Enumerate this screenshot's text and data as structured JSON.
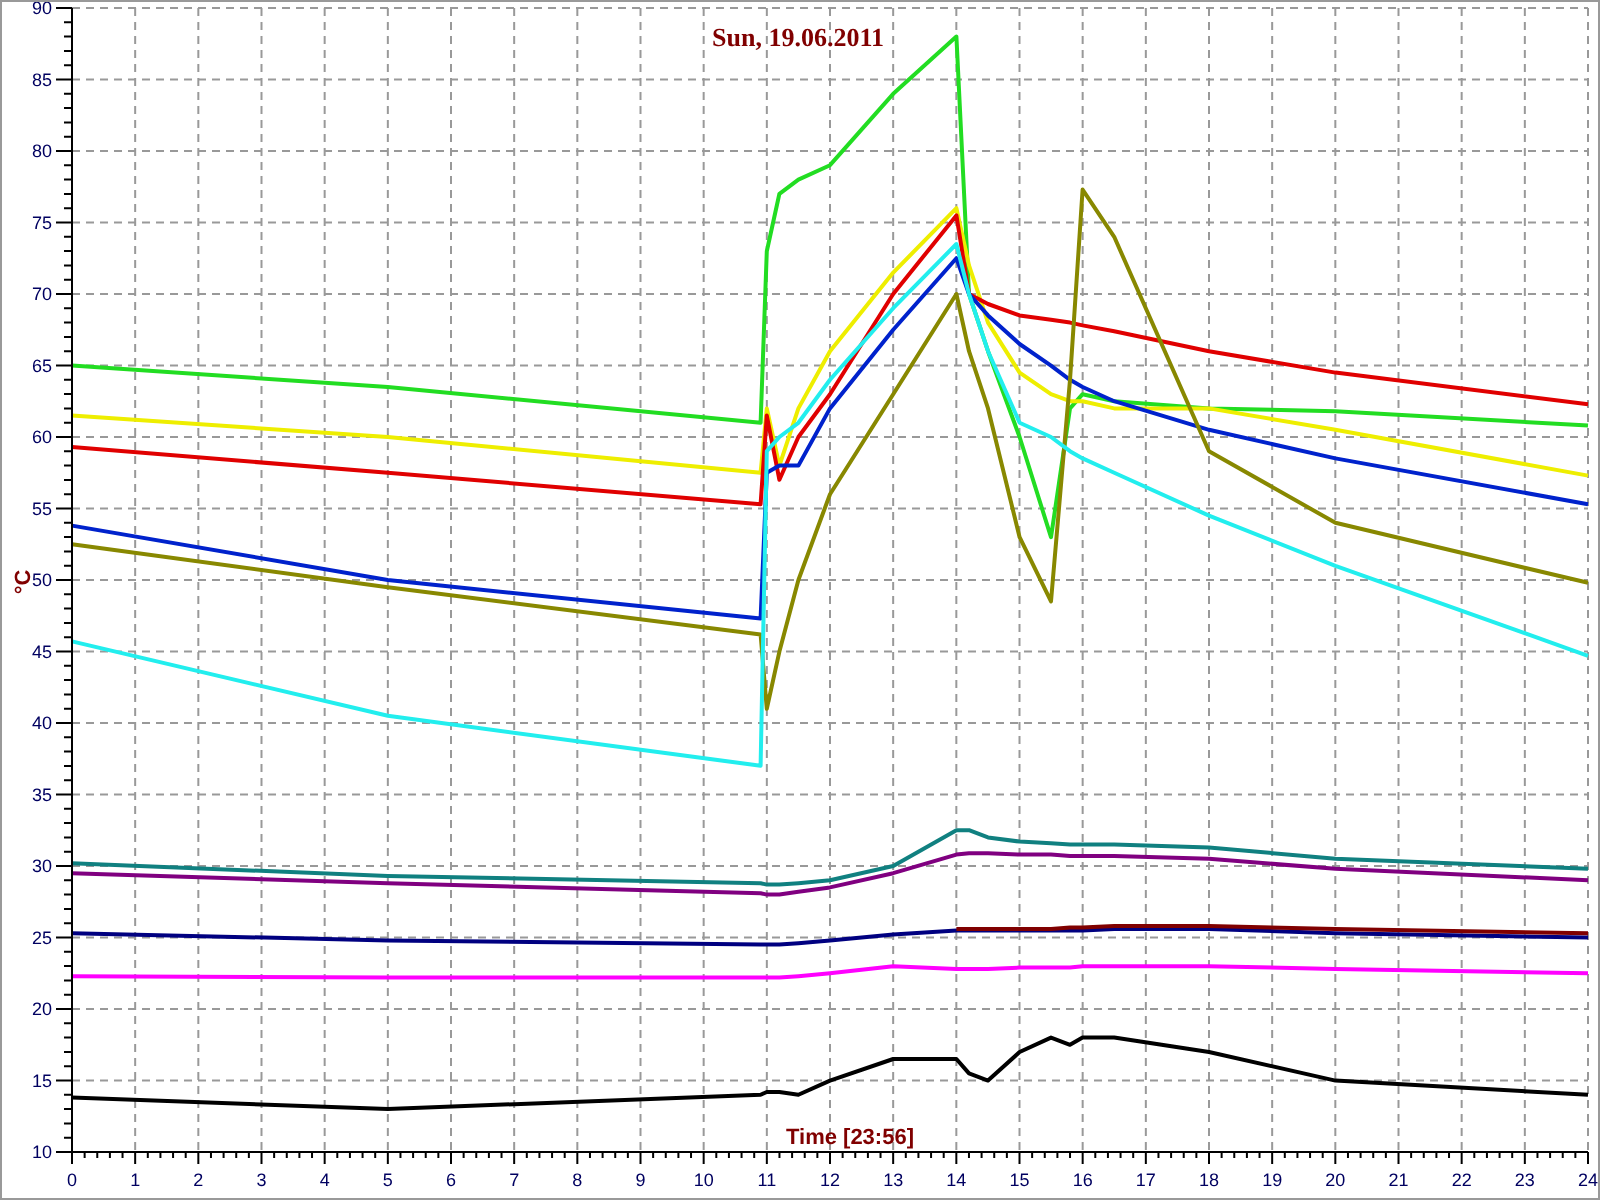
{
  "chart": {
    "chart_data": {
      "type": "line",
      "title": "Sun, 19.06.2011",
      "xlabel": "Time [23:56]",
      "ylabel": "°C",
      "x": [
        0,
        5,
        10.9,
        11,
        11.2,
        11.5,
        12,
        13,
        14,
        14.2,
        14.5,
        15,
        15.5,
        15.8,
        16,
        16.5,
        18,
        20,
        24
      ],
      "grid": true,
      "xlim": [
        0,
        24
      ],
      "ylim": [
        10,
        90
      ],
      "xticks": [
        0,
        1,
        2,
        3,
        4,
        5,
        6,
        7,
        8,
        9,
        10,
        11,
        12,
        13,
        14,
        15,
        16,
        17,
        18,
        19,
        20,
        21,
        22,
        23,
        24
      ],
      "yticks": [
        10,
        15,
        20,
        25,
        30,
        35,
        40,
        45,
        50,
        55,
        60,
        65,
        70,
        75,
        80,
        85,
        90
      ],
      "series": [
        {
          "color": "#22dd22",
          "values": [
            65,
            63.5,
            61,
            73,
            77,
            78,
            79,
            84,
            88,
            70,
            66,
            60,
            53,
            62,
            63,
            62.5,
            62,
            61.8,
            60.8
          ]
        },
        {
          "color": "#eeee00",
          "values": [
            61.5,
            60,
            57.5,
            62,
            58,
            62,
            66,
            71.5,
            76,
            72,
            68,
            64.5,
            63,
            62.5,
            62.5,
            62,
            62,
            60.5,
            57.3
          ]
        },
        {
          "color": "#e00000",
          "values": [
            59.3,
            57.5,
            55.3,
            61.5,
            57,
            60,
            63,
            70,
            75.5,
            70,
            69.3,
            68.5,
            68.2,
            68,
            67.8,
            67.4,
            66,
            64.5,
            62.3
          ]
        },
        {
          "color": "#0022cc",
          "values": [
            53.8,
            50,
            47.3,
            57.5,
            58,
            58,
            62,
            67.5,
            72.5,
            70,
            68.5,
            66.5,
            65,
            64,
            63.5,
            62.5,
            60.5,
            58.5,
            55.3
          ]
        },
        {
          "color": "#888800",
          "values": [
            52.5,
            49.5,
            46.2,
            41,
            45,
            50,
            56,
            63,
            70,
            66,
            62,
            53,
            48.5,
            64,
            77.3,
            74,
            59,
            54,
            49.8
          ]
        },
        {
          "color": "#22eeee",
          "values": [
            45.7,
            40.5,
            37,
            59,
            60,
            61,
            64,
            69,
            73.5,
            70,
            66,
            61,
            60,
            59,
            58.5,
            57.5,
            54.5,
            51,
            44.7
          ]
        },
        {
          "color": "#108080",
          "values": [
            30.2,
            29.3,
            28.8,
            28.7,
            28.7,
            28.8,
            29,
            30,
            32.5,
            32.5,
            32,
            31.7,
            31.6,
            31.5,
            31.5,
            31.5,
            31.3,
            30.5,
            29.8
          ]
        },
        {
          "color": "#800080",
          "values": [
            29.5,
            28.8,
            28.1,
            28,
            28,
            28.2,
            28.5,
            29.5,
            30.8,
            30.9,
            30.9,
            30.8,
            30.8,
            30.7,
            30.7,
            30.7,
            30.5,
            29.8,
            29
          ]
        },
        {
          "color": "#000080",
          "values": [
            25.3,
            24.8,
            24.5,
            24.5,
            24.5,
            24.6,
            24.8,
            25.2,
            25.5,
            25.5,
            25.5,
            25.5,
            25.5,
            25.5,
            25.5,
            25.6,
            25.6,
            25.3,
            25
          ]
        },
        {
          "color": "#800000",
          "values": [
            null,
            null,
            null,
            null,
            null,
            null,
            null,
            null,
            25.6,
            25.6,
            25.6,
            25.6,
            25.6,
            25.7,
            25.7,
            25.8,
            25.8,
            25.6,
            25.3
          ]
        },
        {
          "color": "#ff00ff",
          "values": [
            22.3,
            22.2,
            22.2,
            22.2,
            22.2,
            22.3,
            22.5,
            23,
            22.8,
            22.8,
            22.8,
            22.9,
            22.9,
            22.9,
            23,
            23,
            23,
            22.8,
            22.5
          ]
        },
        {
          "color": "#000000",
          "values": [
            13.8,
            13,
            14,
            14.2,
            14.2,
            14,
            15,
            16.5,
            16.5,
            15.5,
            15,
            17,
            18,
            17.5,
            18,
            18,
            17,
            15,
            14
          ]
        }
      ]
    }
  }
}
